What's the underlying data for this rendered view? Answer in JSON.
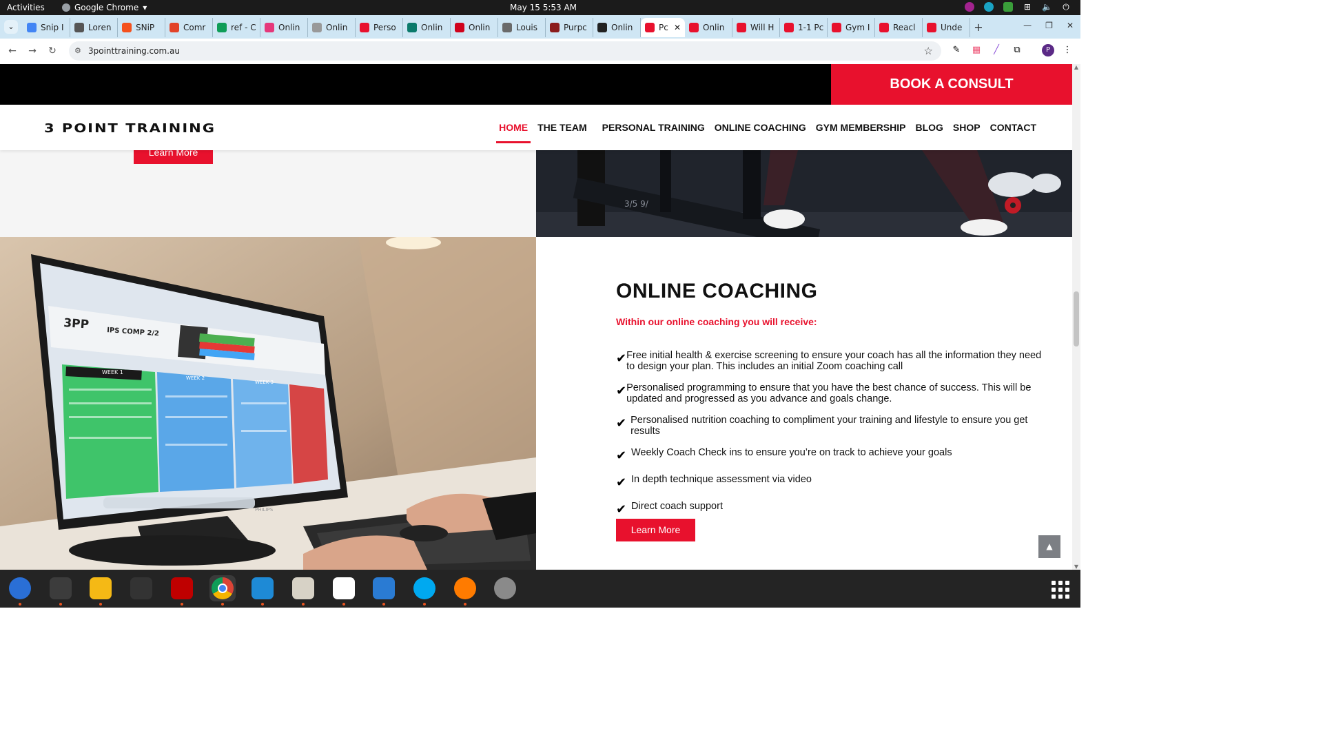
{
  "system": {
    "activities": "Activities",
    "app_name": "Google Chrome",
    "clock": "May 15  5:53 AM"
  },
  "browser": {
    "tabs": [
      {
        "label": "Snip I",
        "color": "#4285f4"
      },
      {
        "label": "Loren",
        "color": "#555555"
      },
      {
        "label": "SNiP",
        "color": "#f4511e"
      },
      {
        "label": "Comr",
        "color": "#e24329"
      },
      {
        "label": "ref - C",
        "color": "#0f9d58"
      },
      {
        "label": "Onlin",
        "color": "#e5377a"
      },
      {
        "label": "Onlin",
        "color": "#999999"
      },
      {
        "label": "Perso",
        "color": "#e8112d"
      },
      {
        "label": "Onlin",
        "color": "#0b7a6b"
      },
      {
        "label": "Onlin",
        "color": "#d0021b"
      },
      {
        "label": "Louis",
        "color": "#6a6a6a"
      },
      {
        "label": "Purpc",
        "color": "#8b1c1c"
      },
      {
        "label": "Onlin",
        "color": "#222222"
      },
      {
        "label": "Pc",
        "color": "#e8112d",
        "active": true
      },
      {
        "label": "Onlin",
        "color": "#e8112d"
      },
      {
        "label": "Will H",
        "color": "#e8112d"
      },
      {
        "label": "1-1 Pc",
        "color": "#e8112d"
      },
      {
        "label": "Gym I",
        "color": "#e8112d"
      },
      {
        "label": "Reacl",
        "color": "#e8112d"
      },
      {
        "label": "Unde",
        "color": "#e8112d"
      }
    ],
    "url": "3pointtraining.com.au",
    "profile_initial": "P"
  },
  "site": {
    "book_consult": "BOOK A CONSULT",
    "logo": "3 POINT TRAINING",
    "nav": [
      {
        "label": "HOME",
        "active": true
      },
      {
        "label": "THE TEAM"
      },
      {
        "label": "PERSONAL TRAINING"
      },
      {
        "label": "ONLINE COACHING"
      },
      {
        "label": "GYM MEMBERSHIP"
      },
      {
        "label": "BLOG"
      },
      {
        "label": "SHOP"
      },
      {
        "label": "CONTACT"
      }
    ],
    "prev_learn_more": "Learn More",
    "section": {
      "title": "ONLINE COACHING",
      "subtitle": "Within our online coaching you will receive:",
      "items": [
        "Free initial health & exercise screening to ensure your coach has all the information they need to design your plan. This includes an initial Zoom coaching call",
        "Personalised programming to ensure that you have the best chance of success. This will be updated and progressed as you advance and goals change.",
        "Personalised nutrition coaching to compliment your training and lifestyle to ensure you get results",
        "Weekly Coach Check ins to ensure you’re on track to achieve your goals",
        "In depth technique assessment via video",
        "Direct coach support"
      ],
      "learn_more": "Learn More"
    },
    "monitor_screen": {
      "brand": "3PP",
      "sheet_title": "IPS COMP 2/2",
      "week1": "WEEK 1",
      "week2": "WEEK 2",
      "week3": "WEEK 3",
      "monitor_brand": "PHILIPS"
    },
    "bench_label": "3/5 9/"
  },
  "colors": {
    "accent": "#e8112d",
    "black": "#000000",
    "tabstrip": "#cfe6f4",
    "dock": "#242424"
  },
  "dock": [
    {
      "name": "thunderbird-icon",
      "color": "#2a6fd6",
      "running": true
    },
    {
      "name": "terminal-icon",
      "color": "#3c3c3c",
      "running": true
    },
    {
      "name": "calculator-icon",
      "color": "#f5b915",
      "running": true
    },
    {
      "name": "system-monitor-icon",
      "color": "#333333",
      "running": false
    },
    {
      "name": "filezilla-icon",
      "color": "#bf0000",
      "running": true
    },
    {
      "name": "chrome-icon",
      "color": "#ffffff",
      "running": true
    },
    {
      "name": "vscode-icon",
      "color": "#1e8ad6",
      "running": true
    },
    {
      "name": "files-icon",
      "color": "#d7d2c6",
      "running": true
    },
    {
      "name": "text-editor-icon",
      "color": "#ffffff",
      "running": true
    },
    {
      "name": "libreoffice-writer-icon",
      "color": "#2a7bd3",
      "running": true
    },
    {
      "name": "skype-icon",
      "color": "#00a9f0",
      "running": true
    },
    {
      "name": "firefox-like-icon",
      "color": "#ff7b00",
      "running": true
    },
    {
      "name": "disk-icon",
      "color": "#8a8a8a",
      "running": false
    }
  ]
}
